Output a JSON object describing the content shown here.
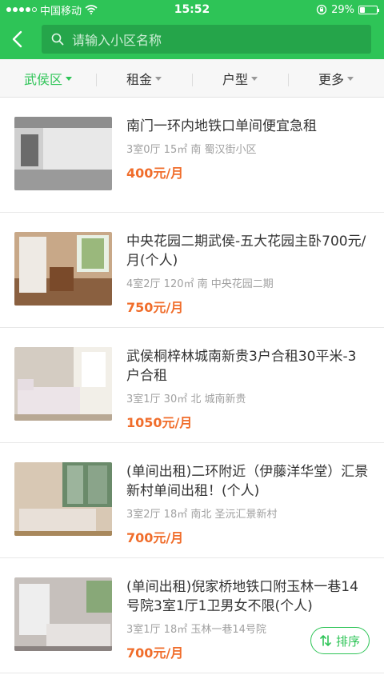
{
  "status": {
    "carrier": "中国移动",
    "time": "15:52",
    "battery": "29%",
    "battery_level": 0.29
  },
  "search": {
    "placeholder": "请输入小区名称"
  },
  "filters": [
    {
      "label": "武侯区",
      "active": true
    },
    {
      "label": "租金",
      "active": false
    },
    {
      "label": "户型",
      "active": false
    },
    {
      "label": "更多",
      "active": false
    }
  ],
  "listings": [
    {
      "title": "南门一环内地铁口单间便宜急租",
      "meta": "3室0厅 15㎡ 南 蜀汉街小区",
      "price": "400元/月"
    },
    {
      "title": "中央花园二期武侯-五大花园主卧700元/月(个人)",
      "meta": "4室2厅 120㎡ 南 中央花园二期",
      "price": "750元/月"
    },
    {
      "title": "武侯桐梓林城南新贵3户合租30平米-3户合租",
      "meta": "3室1厅 30㎡ 北 城南新贵",
      "price": "1050元/月"
    },
    {
      "title": "(单间出租)二环附近（伊藤洋华堂）汇景新村单间出租！(个人)",
      "meta": "3室2厅 18㎡ 南北 圣沅汇景新村",
      "price": "700元/月"
    },
    {
      "title": "(单间出租)倪家桥地铁口附玉林一巷14号院3室1厅1卫男女不限(个人)",
      "meta": "3室1厅 18㎡ 玉林一巷14号院",
      "price": "700元/月"
    }
  ],
  "sort": {
    "label": "排序"
  },
  "colors": {
    "brand": "#2ec457",
    "price": "#f06d2b"
  }
}
